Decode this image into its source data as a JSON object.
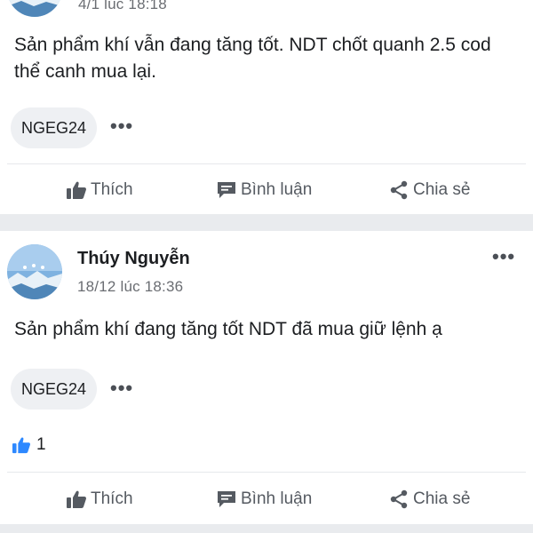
{
  "colors": {
    "text": "#1c1e21",
    "muted": "#6a6d72",
    "action": "#555a61",
    "like_blue": "#2d88ff",
    "tag_bg": "#eef0f3",
    "separator": "#e9ebee"
  },
  "posts": [
    {
      "author": "",
      "time": "4/1 lúc 18:18",
      "text": "Sản phẩm khí vẫn đang tăng tốt. NDT chốt quanh 2.5 cod thể canh mua lại.",
      "tag": "NGEG24",
      "more_label": "•••",
      "actions": {
        "like": "Thích",
        "comment": "Bình luận",
        "share": "Chia sẻ"
      }
    },
    {
      "author": "Thúy Nguyễn",
      "time": "18/12 lúc 18:36",
      "text": "Sản phẩm khí đang tăng tốt NDT đã mua giữ lệnh ạ",
      "tag": "NGEG24",
      "more_label": "•••",
      "menu_label": "•••",
      "like_count": "1",
      "actions": {
        "like": "Thích",
        "comment": "Bình luận",
        "share": "Chia sẻ"
      }
    }
  ],
  "icons": {
    "avatar": "avatar-landscape",
    "like": "thumbs-up-icon",
    "comment": "comment-bubble-icon",
    "share": "share-icon"
  }
}
